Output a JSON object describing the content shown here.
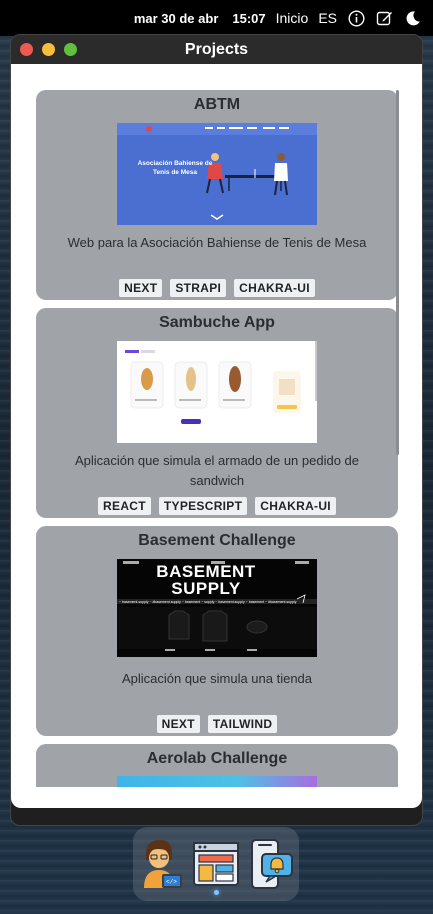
{
  "menubar": {
    "date": "mar 30 de abr",
    "time": "15:07",
    "inicio": "Inicio",
    "lang": "ES",
    "icons": [
      "info-icon",
      "edit-icon",
      "dark-mode-icon"
    ]
  },
  "window": {
    "title": "Projects"
  },
  "projects": [
    {
      "title": "ABTM",
      "image_text": "Asociación Bahiense de Tenis de Mesa",
      "description": "Web para la Asociación Bahiense de Tenis de Mesa",
      "tags": [
        "NEXT",
        "STRAPI",
        "CHAKRA-UI"
      ]
    },
    {
      "title": "Sambuche App",
      "description": "Aplicación que simula el armado de un pedido de sandwich",
      "tags": [
        "REACT",
        "TYPESCRIPT",
        "CHAKRA-UI"
      ]
    },
    {
      "title": "Basement Challenge",
      "image_text": "BASEMENT SUPPLY",
      "description": "Aplicación que simula una tienda",
      "tags": [
        "NEXT",
        "TAILWIND"
      ]
    },
    {
      "title": "Aerolab Challenge"
    }
  ],
  "dock": {
    "apps": [
      "developer-avatar-icon",
      "web-layout-icon",
      "notifications-app-icon"
    ]
  },
  "colors": {
    "card_bg": "#a0a4a8",
    "tag_bg": "#eef0f2",
    "abtm_blue": "#4a6fd1",
    "traffic_red": "#ee5a52",
    "traffic_yellow": "#f5be3b",
    "traffic_green": "#5fc13b"
  }
}
